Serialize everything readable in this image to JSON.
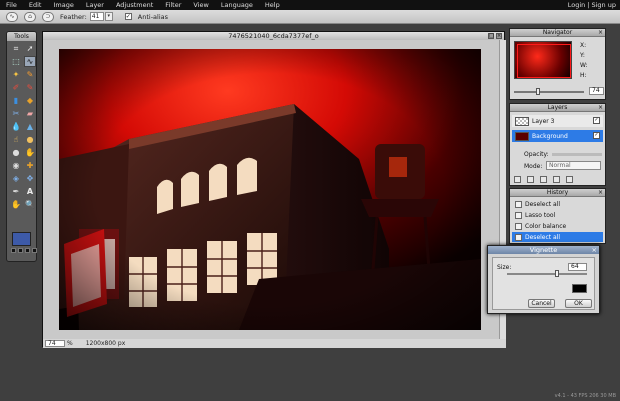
{
  "menu": {
    "items": [
      "File",
      "Edit",
      "Image",
      "Layer",
      "Adjustment",
      "Filter",
      "View",
      "Language",
      "Help"
    ],
    "login": "Login",
    "sep": "|",
    "signup": "Sign up"
  },
  "options": {
    "feather_label": "Feather:",
    "feather_value": "41",
    "antialias_label": "Anti-alias"
  },
  "tools": {
    "title": "Tools"
  },
  "document": {
    "title": "7476521040_6cda7377ef_o",
    "zoom": "74",
    "zoom_unit": "%",
    "dimensions": "1200x800 px"
  },
  "navigator": {
    "title": "Navigator",
    "x_label": "X:",
    "y_label": "Y:",
    "w_label": "W:",
    "h_label": "H:",
    "zoom": "74"
  },
  "layers": {
    "title": "Layers",
    "items": [
      {
        "name": "Layer 3"
      },
      {
        "name": "Background"
      }
    ],
    "opacity_label": "Opacity:",
    "mode_label": "Mode:",
    "mode_value": "Normal"
  },
  "history": {
    "title": "History",
    "items": [
      "Deselect all",
      "Lasso tool",
      "Color balance",
      "Deselect all"
    ],
    "active_index": 3
  },
  "vignette": {
    "title": "Vignette",
    "size_label": "Size:",
    "size_value": "64",
    "cancel_label": "Cancel",
    "ok_label": "OK"
  },
  "footer": {
    "text": "v4.1 - 43 FPS 206 30 MB"
  },
  "colors": {
    "accent": "#2d7be6",
    "foreground": "#3d5aa8",
    "vignette_color": "#000000"
  }
}
